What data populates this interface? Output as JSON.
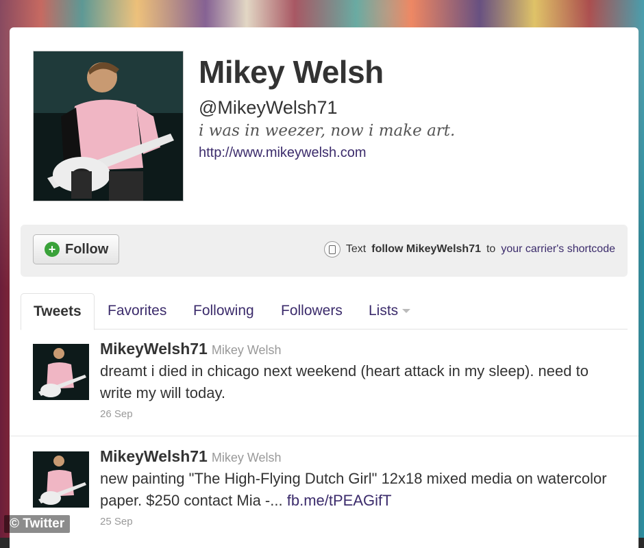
{
  "profile": {
    "name": "Mikey Welsh",
    "handle": "@MikeyWelsh71",
    "bio": "i was in weezer, now i make art.",
    "url": "http://www.mikeywelsh.com"
  },
  "follow_bar": {
    "follow_label": "Follow",
    "sms_prefix": "Text",
    "sms_command": "follow MikeyWelsh71",
    "sms_to": "to",
    "sms_link": "your carrier's shortcode"
  },
  "tabs": [
    {
      "label": "Tweets",
      "active": true
    },
    {
      "label": "Favorites"
    },
    {
      "label": "Following"
    },
    {
      "label": "Followers"
    },
    {
      "label": "Lists"
    }
  ],
  "tweets": [
    {
      "username": "MikeyWelsh71",
      "real_name": "Mikey Welsh",
      "text": "dreamt i died in chicago next weekend (heart attack in my sleep). need to write my will today.",
      "date": "26 Sep"
    },
    {
      "username": "MikeyWelsh71",
      "real_name": "Mikey Welsh",
      "text": "new painting \"The High-Flying Dutch Girl\" 12x18 mixed media on watercolor paper. $250 contact Mia -...",
      "link": "fb.me/tPEAGifT",
      "date": "25 Sep"
    }
  ],
  "watermark": "© Twitter",
  "colors": {
    "link": "#3b2b6b",
    "follow_plus": "#3aa23a"
  }
}
